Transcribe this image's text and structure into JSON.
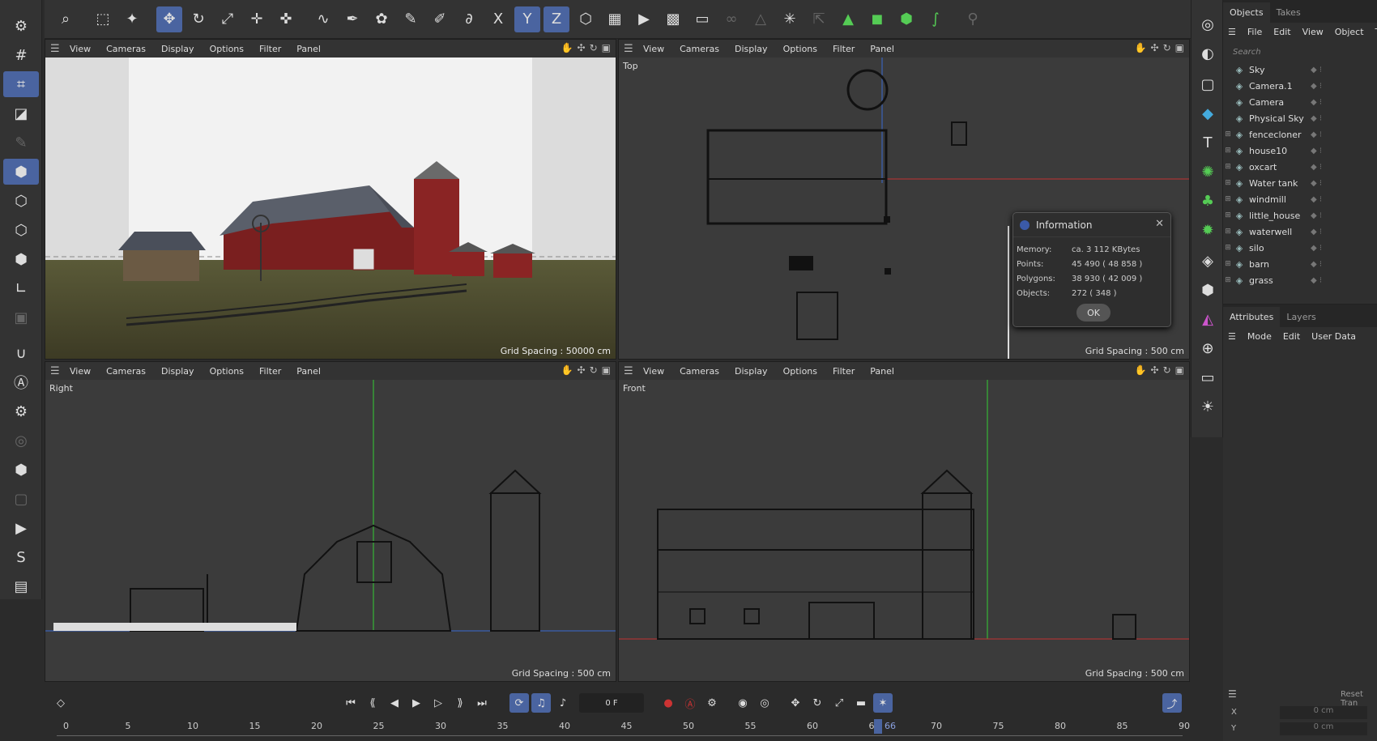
{
  "toolbar": {
    "icons": [
      "zoom-icon",
      "select-icon",
      "live-select-icon",
      "move-icon",
      "rotate-icon",
      "scale-icon",
      "move-tool-icon",
      "transform-icon",
      "spline-icon",
      "pen-icon",
      "sculpt-icon",
      "paint-icon",
      "brush-icon",
      "knife-icon",
      "x-axis-icon",
      "y-axis-icon",
      "z-axis-icon",
      "coordinate-icon",
      "render-region-icon",
      "render-view-icon",
      "render-settings-icon",
      "picture-viewer-icon",
      "link-icon",
      "snap-icon",
      "workplane-icon",
      "axis-icon",
      "python-icon",
      "cube-icon",
      "cube-outline-icon",
      "spline-tool-icon",
      "figure-icon"
    ]
  },
  "viewports": {
    "menu": [
      "View",
      "Cameras",
      "Display",
      "Options",
      "Filter",
      "Panel"
    ],
    "perspective": {
      "label": "",
      "grid": "Grid Spacing : 50000 cm"
    },
    "top": {
      "label": "Top",
      "grid": "Grid Spacing : 500 cm"
    },
    "right": {
      "label": "Right",
      "grid": "Grid Spacing : 500 cm"
    },
    "front": {
      "label": "Front",
      "grid": "Grid Spacing : 500 cm"
    }
  },
  "objects_panel": {
    "tabs": [
      "Objects",
      "Takes"
    ],
    "menu": [
      "File",
      "Edit",
      "View",
      "Object",
      "Ta"
    ],
    "search_placeholder": "Search",
    "items": [
      {
        "name": "Sky",
        "icon": "sky-icon"
      },
      {
        "name": "Camera.1",
        "icon": "camera-icon"
      },
      {
        "name": "Camera",
        "icon": "camera-icon"
      },
      {
        "name": "Physical Sky",
        "icon": "physical-sky-icon"
      },
      {
        "name": "fencecloner",
        "icon": "cloner-icon"
      },
      {
        "name": "house10",
        "icon": "null-icon"
      },
      {
        "name": "oxcart",
        "icon": "null-icon"
      },
      {
        "name": "Water tank",
        "icon": "null-icon"
      },
      {
        "name": "windmill",
        "icon": "null-icon"
      },
      {
        "name": "little_house",
        "icon": "null-icon"
      },
      {
        "name": "waterwell",
        "icon": "null-icon"
      },
      {
        "name": "silo",
        "icon": "null-icon"
      },
      {
        "name": "barn",
        "icon": "null-icon"
      },
      {
        "name": "grass",
        "icon": "polygon-icon"
      }
    ]
  },
  "attributes_panel": {
    "tabs": [
      "Attributes",
      "Layers"
    ],
    "menu": [
      "Mode",
      "Edit",
      "User Data"
    ],
    "reset_label": "Reset Tran",
    "x_label": "X",
    "y_label": "Y",
    "x_value": "0 cm",
    "y_value": "0 cm"
  },
  "info_dialog": {
    "title": "Information",
    "memory_label": "Memory:",
    "memory_value": "ca. 3 112 KBytes",
    "points_label": "Points:",
    "points_value": "45 490 ( 48 858 )",
    "polygons_label": "Polygons:",
    "polygons_value": "38 930 ( 42 009 )",
    "objects_label": "Objects:",
    "objects_value": "272 ( 348 )",
    "ok_label": "OK"
  },
  "timeline": {
    "frame": "0 F",
    "current_frame": "66",
    "ruler": [
      "0",
      "5",
      "10",
      "15",
      "20",
      "25",
      "30",
      "35",
      "40",
      "45",
      "50",
      "55",
      "60",
      "65",
      "70",
      "75",
      "80",
      "85",
      "90"
    ]
  }
}
